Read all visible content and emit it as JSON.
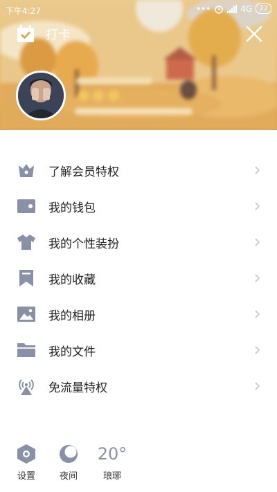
{
  "status_bar": {
    "time": "下午4:27",
    "network": "4G",
    "battery": "77"
  },
  "header": {
    "checkin_label": "打卡"
  },
  "menu": [
    {
      "label": "了解会员特权",
      "icon": "crown-icon"
    },
    {
      "label": "我的钱包",
      "icon": "wallet-icon"
    },
    {
      "label": "我的个性装扮",
      "icon": "shirt-icon"
    },
    {
      "label": "我的收藏",
      "icon": "bookmark-icon"
    },
    {
      "label": "我的相册",
      "icon": "image-icon"
    },
    {
      "label": "我的文件",
      "icon": "folder-icon"
    },
    {
      "label": "免流量特权",
      "icon": "signal-tower-icon"
    }
  ],
  "bottom_bar": {
    "settings_label": "设置",
    "night_label": "夜间",
    "temperature": "20°",
    "city": "琅琊"
  },
  "colors": {
    "icon_gray": "#8a91a6",
    "chevron": "#c4c7cf"
  }
}
